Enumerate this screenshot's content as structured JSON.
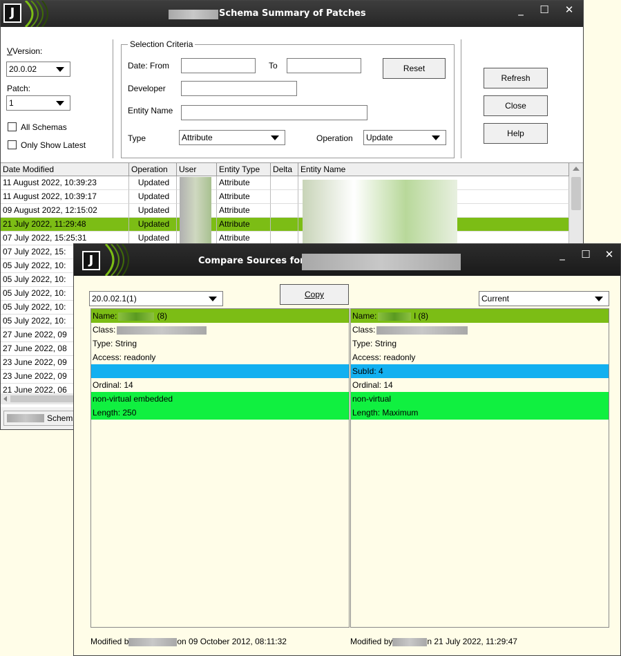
{
  "main_window": {
    "title": "Schema Summary of Patches",
    "controls": {
      "minimize": "_",
      "maximize": "☐",
      "close": "✕"
    },
    "version_label": "Version:",
    "version_value": "20.0.02",
    "patch_label": "Patch:",
    "patch_value": "1",
    "all_schemas_label": "All Schemas",
    "only_latest_label": "Only Show Latest",
    "selection_criteria": {
      "legend": "Selection Criteria",
      "date_from_label": "Date: From",
      "to_label": "To",
      "developer_label": "Developer",
      "entity_name_label": "Entity Name",
      "type_label": "Type",
      "type_value": "Attribute",
      "operation_label": "Operation",
      "operation_value": "Update",
      "reset_button": "Reset"
    },
    "refresh_button": "Refresh",
    "close_button": "Close",
    "help_button": "Help",
    "grid": {
      "columns": [
        "Date Modified",
        "Operation",
        "User",
        "Entity Type",
        "Delta",
        "Entity Name"
      ],
      "rows": [
        {
          "date": "11 August 2022, 10:39:23",
          "op": "Updated",
          "type": "Attribute"
        },
        {
          "date": "11 August 2022, 10:39:17",
          "op": "Updated",
          "type": "Attribute"
        },
        {
          "date": "09 August 2022, 12:15:02",
          "op": "Updated",
          "type": "Attribute"
        },
        {
          "date": "21 July 2022, 11:29:48",
          "op": "Updated",
          "type": "Attribute"
        },
        {
          "date": "07 July 2022, 15:25:31",
          "op": "Updated",
          "type": "Attribute"
        },
        {
          "date": "07 July 2022, 15:",
          "op": "",
          "type": ""
        },
        {
          "date": "05 July 2022, 10:",
          "op": "",
          "type": ""
        },
        {
          "date": "05 July 2022, 10:",
          "op": "",
          "type": ""
        },
        {
          "date": "05 July 2022, 10:",
          "op": "",
          "type": ""
        },
        {
          "date": "05 July 2022, 10:",
          "op": "",
          "type": ""
        },
        {
          "date": "05 July 2022, 10:",
          "op": "",
          "type": ""
        },
        {
          "date": "27 June 2022, 09",
          "op": "",
          "type": ""
        },
        {
          "date": "27 June 2022, 08",
          "op": "",
          "type": ""
        },
        {
          "date": "23 June 2022, 09",
          "op": "",
          "type": ""
        },
        {
          "date": "23 June 2022, 09",
          "op": "",
          "type": ""
        },
        {
          "date": "21 June 2022, 06",
          "op": "",
          "type": ""
        }
      ]
    },
    "status_text": "Schema"
  },
  "compare_window": {
    "title": "Compare Sources for",
    "controls": {
      "minimize": "_",
      "maximize": "☐",
      "close": "✕"
    },
    "left_version": "20.0.02.1(1)",
    "copy_button": "Copy",
    "right_version": "Current",
    "left_lines": [
      {
        "text": "Name:",
        "suffix": "(8)"
      },
      {
        "text": "Class:",
        "suffix": ""
      },
      {
        "text": "Type: String",
        "suffix": ""
      },
      {
        "text": "Access: readonly",
        "suffix": ""
      },
      {
        "text": "",
        "suffix": ""
      },
      {
        "text": "Ordinal: 14",
        "suffix": ""
      },
      {
        "text": "non-virtual embedded",
        "suffix": ""
      },
      {
        "text": "Length: 250",
        "suffix": ""
      }
    ],
    "right_lines": [
      {
        "text": "Name:",
        "suffix": "l (8)"
      },
      {
        "text": "Class:",
        "suffix": ""
      },
      {
        "text": "Type: String",
        "suffix": ""
      },
      {
        "text": "Access: readonly",
        "suffix": ""
      },
      {
        "text": "SubId: 4",
        "suffix": ""
      },
      {
        "text": "Ordinal: 14",
        "suffix": ""
      },
      {
        "text": "non-virtual",
        "suffix": ""
      },
      {
        "text": "Length: Maximum",
        "suffix": ""
      }
    ],
    "left_modified_prefix": "Modified b",
    "left_modified_suffix": "on 09 October 2012, 08:11:32",
    "right_modified_prefix": "Modified by",
    "right_modified_suffix": "n 21 July 2022, 11:29:47"
  },
  "colors": {
    "selected_row": "#7cbd15",
    "diff_name": "#7cbd15",
    "diff_changed": "#10f040",
    "diff_added": "#12b0f0",
    "pane_background": "#fffde8"
  }
}
